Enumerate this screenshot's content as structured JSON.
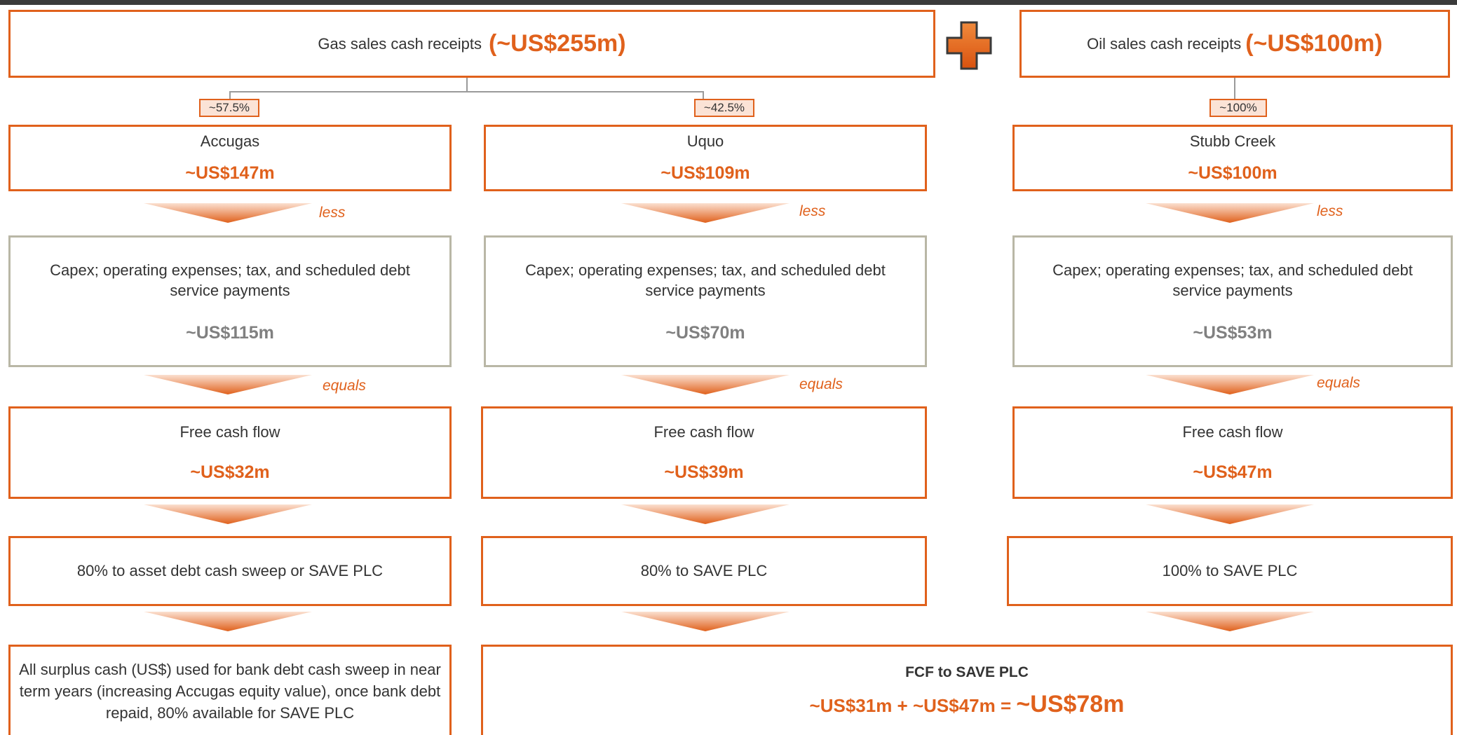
{
  "top": {
    "gas_label": "Gas sales cash receipts",
    "gas_value": "(~US$255m)",
    "oil_label": "Oil sales cash receipts",
    "oil_value": "(~US$100m)"
  },
  "columns": [
    {
      "pct": "~57.5%",
      "asset": "Accugas",
      "asset_value": "~US$147m",
      "less": "less",
      "costs_label": "Capex; operating expenses; tax, and scheduled debt service payments",
      "costs_value": "~US$115m",
      "equals": "equals",
      "fcf_label": "Free cash flow",
      "fcf_value": "~US$32m",
      "dest": "80% to asset debt cash sweep or SAVE PLC"
    },
    {
      "pct": "~42.5%",
      "asset": "Uquo",
      "asset_value": "~US$109m",
      "less": "less",
      "costs_label": "Capex; operating expenses; tax, and scheduled debt service payments",
      "costs_value": "~US$70m",
      "equals": "equals",
      "fcf_label": "Free cash flow",
      "fcf_value": "~US$39m",
      "dest": "80% to SAVE PLC"
    },
    {
      "pct": "~100%",
      "asset": "Stubb Creek",
      "asset_value": "~US$100m",
      "less": "less",
      "costs_label": "Capex; operating expenses; tax, and scheduled debt service payments",
      "costs_value": "~US$53m",
      "equals": "equals",
      "fcf_label": "Free cash flow",
      "fcf_value": "~US$47m",
      "dest": "100% to SAVE PLC"
    }
  ],
  "bottom": {
    "surplus_text": "All surplus cash (US$) used for bank debt cash sweep in near term years (increasing Accugas equity value), once bank debt repaid, 80% available for SAVE PLC",
    "fcf_title": "FCF to SAVE PLC",
    "fcf_sum": "~US$31m + ~US$47m = ",
    "fcf_total": "~US$78m"
  },
  "icons": {
    "plus": "plus-icon"
  },
  "colors": {
    "accent": "#e0611c",
    "grey_border": "#b9b7a6",
    "pct_fill": "#fbe3d6"
  }
}
